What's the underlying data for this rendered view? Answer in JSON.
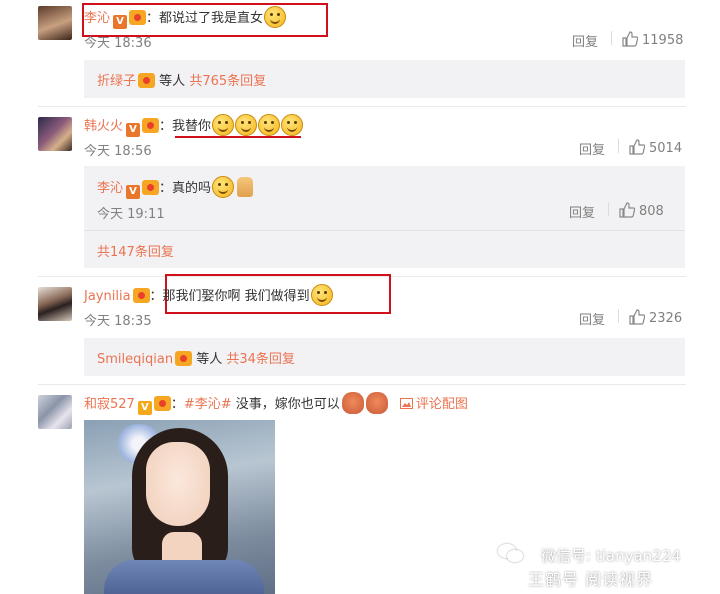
{
  "comments": [
    {
      "user": "李沁",
      "text": "：都说过了我是直女",
      "time": "今天 18:36",
      "reply": "回复",
      "likes": "11958",
      "summary_user": "折绿子",
      "summary_mid": "等人",
      "summary_count": "共765条回复"
    },
    {
      "user": "韩火火",
      "text_prefix": "：",
      "text_underlined": "我替你",
      "time": "今天 18:56",
      "reply": "回复",
      "likes": "5014",
      "subreply": {
        "user": "李沁",
        "text": "：真的吗",
        "time": "今天 19:11",
        "reply": "回复",
        "likes": "808",
        "total": "共147条回复"
      }
    },
    {
      "user": "Jaynilia",
      "text": "：那我们娶你啊 我们做得到",
      "time": "今天 18:35",
      "reply": "回复",
      "likes": "2326",
      "summary_user": "Smileqiqian",
      "summary_mid": "等人",
      "summary_count": "共34条回复"
    },
    {
      "user": "和寂527",
      "topic": "#李沁#",
      "text": " 没事，嫁你也可以",
      "pic_link": "评论配图"
    }
  ],
  "watermark": "微信号: tianyan224",
  "watermark2": "王鹤号 阅读视界",
  "colors": {
    "name": "#eb7350",
    "highlight": "#d0101b",
    "meta": "#808080",
    "subreply_bg": "#f2f2f5"
  }
}
